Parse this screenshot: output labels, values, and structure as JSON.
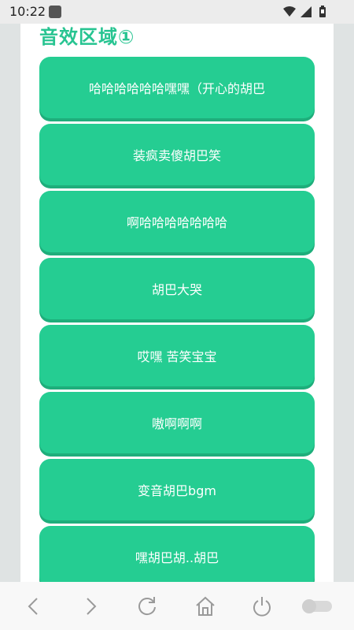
{
  "status_bar": {
    "time": "10:22",
    "icons": [
      "notification-icon",
      "wifi-icon",
      "signal-icon",
      "battery-icon"
    ]
  },
  "content": {
    "section_title": "音效区域①",
    "buttons": [
      {
        "label": "哈哈哈哈哈哈嘿嘿（开心的胡巴"
      },
      {
        "label": "装疯卖傻胡巴笑"
      },
      {
        "label": "啊哈哈哈哈哈哈哈"
      },
      {
        "label": "胡巴大哭"
      },
      {
        "label": "哎嘿 苦笑宝宝"
      },
      {
        "label": "嗷啊啊啊"
      },
      {
        "label": "变音胡巴bgm"
      },
      {
        "label": "嘿胡巴胡..胡巴"
      }
    ]
  },
  "bottom_nav": {
    "icons": [
      "back-icon",
      "forward-icon",
      "reload-icon",
      "home-icon",
      "power-icon",
      "toggle-icon"
    ]
  },
  "colors": {
    "accent": "#25cd92",
    "accent_shadow": "#1eae7b",
    "title": "#27c491"
  }
}
